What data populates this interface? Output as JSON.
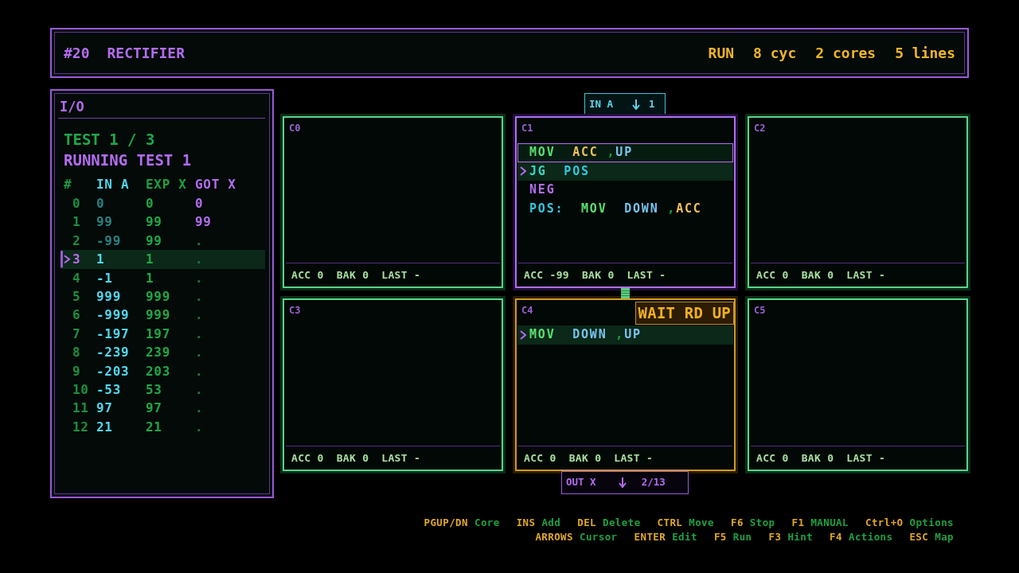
{
  "header": {
    "level": "#20",
    "title": "RECTIFIER",
    "stats": [
      "RUN",
      "8 cyc",
      "2 cores",
      "5 lines"
    ]
  },
  "io": {
    "title": "I/O",
    "progress": "TEST 1 / 3",
    "status": "RUNNING TEST 1",
    "columns": [
      "#",
      "IN A",
      "EXP X",
      "GOT X"
    ],
    "rows": [
      {
        "index": "0",
        "in": "0",
        "read": true,
        "expected": "0",
        "got": "0",
        "pending": false,
        "selected": false
      },
      {
        "index": "1",
        "in": "99",
        "read": true,
        "expected": "99",
        "got": "99",
        "pending": false,
        "selected": false
      },
      {
        "index": "2",
        "in": "-99",
        "read": true,
        "expected": "99",
        "got": ".",
        "pending": true,
        "selected": false
      },
      {
        "index": "3",
        "in": "1",
        "read": false,
        "expected": "1",
        "got": ".",
        "pending": true,
        "selected": true
      },
      {
        "index": "4",
        "in": "-1",
        "read": false,
        "expected": "1",
        "got": ".",
        "pending": true,
        "selected": false
      },
      {
        "index": "5",
        "in": "999",
        "read": false,
        "expected": "999",
        "got": ".",
        "pending": true,
        "selected": false
      },
      {
        "index": "6",
        "in": "-999",
        "read": false,
        "expected": "999",
        "got": ".",
        "pending": true,
        "selected": false
      },
      {
        "index": "7",
        "in": "-197",
        "read": false,
        "expected": "197",
        "got": ".",
        "pending": true,
        "selected": false
      },
      {
        "index": "8",
        "in": "-239",
        "read": false,
        "expected": "239",
        "got": ".",
        "pending": true,
        "selected": false
      },
      {
        "index": "9",
        "in": "-203",
        "read": false,
        "expected": "203",
        "got": ".",
        "pending": true,
        "selected": false
      },
      {
        "index": "10",
        "in": "-53",
        "read": false,
        "expected": "53",
        "got": ".",
        "pending": true,
        "selected": false
      },
      {
        "index": "11",
        "in": "97",
        "read": false,
        "expected": "97",
        "got": ".",
        "pending": true,
        "selected": false
      },
      {
        "index": "12",
        "in": "21",
        "read": false,
        "expected": "21",
        "got": ".",
        "pending": true,
        "selected": false
      }
    ]
  },
  "input_port": {
    "label": "IN A",
    "value": "1"
  },
  "cores": [
    {
      "name": "C0",
      "selected": false,
      "blocked": false,
      "registers": [
        "ACC 0",
        "BAK 0",
        "LAST -"
      ]
    },
    {
      "name": "C1",
      "selected": true,
      "blocked": false,
      "lines": [
        {
          "tokens": [
            {
              "text": "MOV",
              "kind": "op"
            },
            {
              "text": "ACC",
              "kind": "register"
            },
            {
              "text": ",",
              "kind": "comma"
            },
            {
              "text": "UP",
              "kind": "port"
            }
          ],
          "selected": true,
          "current": false
        },
        {
          "tokens": [
            {
              "text": "JG",
              "kind": "jump"
            },
            {
              "text": "POS",
              "kind": "label"
            }
          ],
          "selected": false,
          "current": true
        },
        {
          "tokens": [
            {
              "text": "NEG",
              "kind": "alu"
            }
          ],
          "selected": false,
          "current": false
        },
        {
          "tokens": [
            {
              "text": "POS:",
              "kind": "label"
            },
            {
              "text": "MOV",
              "kind": "op"
            },
            {
              "text": "DOWN",
              "kind": "port"
            },
            {
              "text": ",",
              "kind": "comma"
            },
            {
              "text": "ACC",
              "kind": "register"
            }
          ],
          "selected": false,
          "current": false
        }
      ],
      "registers": [
        "ACC -99",
        "BAK 0",
        "LAST -"
      ]
    },
    {
      "name": "C2",
      "selected": false,
      "blocked": false,
      "registers": [
        "ACC 0",
        "BAK 0",
        "LAST -"
      ]
    },
    {
      "name": "C3",
      "selected": false,
      "blocked": false,
      "registers": [
        "ACC 0",
        "BAK 0",
        "LAST -"
      ]
    },
    {
      "name": "C4",
      "selected": false,
      "blocked": true,
      "badge": "WAIT RD UP",
      "lines": [
        {
          "tokens": [
            {
              "text": "MOV",
              "kind": "op"
            },
            {
              "text": "DOWN",
              "kind": "port"
            },
            {
              "text": ",",
              "kind": "comma"
            },
            {
              "text": "UP",
              "kind": "port"
            }
          ],
          "selected": false,
          "current": true
        }
      ],
      "registers": [
        "ACC 0",
        "BAK 0",
        "LAST -"
      ]
    },
    {
      "name": "C5",
      "selected": false,
      "blocked": false,
      "registers": [
        "ACC 0",
        "BAK 0",
        "LAST -"
      ]
    }
  ],
  "output_port": {
    "label": "OUT X",
    "value": "2/13"
  },
  "shortcuts": [
    [
      {
        "key": "PGUP/DN",
        "action": "Core"
      },
      {
        "key": "INS",
        "action": "Add"
      },
      {
        "key": "DEL",
        "action": "Delete"
      },
      {
        "key": "CTRL",
        "action": "Move"
      },
      {
        "key": "F6",
        "action": "Stop"
      },
      {
        "key": "F1",
        "action": "MANUAL"
      },
      {
        "key": "Ctrl+O",
        "action": "Options"
      }
    ],
    [
      {
        "key": "ARROWS",
        "action": "Cursor"
      },
      {
        "key": "ENTER",
        "action": "Edit"
      },
      {
        "key": "F5",
        "action": "Run"
      },
      {
        "key": "F3",
        "action": "Hint"
      },
      {
        "key": "F4",
        "action": "Actions"
      },
      {
        "key": "ESC",
        "action": "Map"
      }
    ]
  ]
}
